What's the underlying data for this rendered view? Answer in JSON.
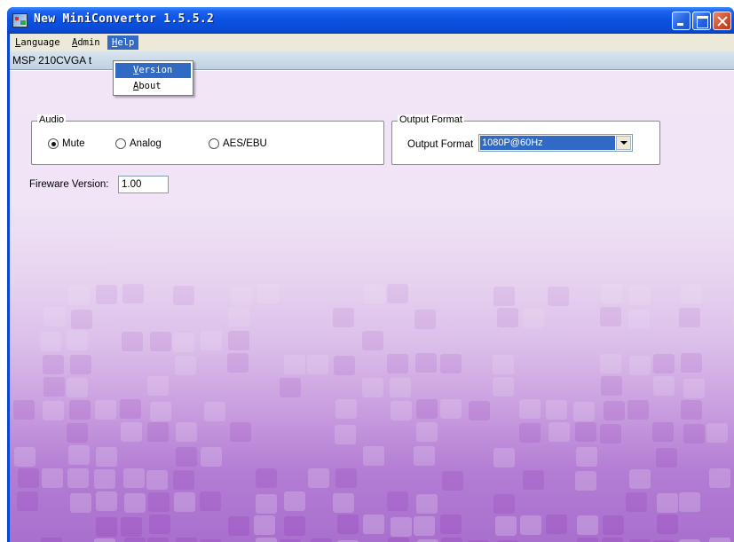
{
  "window": {
    "title": "New MiniConvertor 1.5.5.2"
  },
  "menubar": {
    "items": [
      {
        "label_underline": "L",
        "label_rest": "anguage"
      },
      {
        "label_underline": "A",
        "label_rest": "dmin"
      },
      {
        "label_underline": "H",
        "label_rest": "elp"
      }
    ]
  },
  "help_menu": {
    "items": [
      {
        "label_underline": "V",
        "label_rest": "ersion"
      },
      {
        "label_underline": "A",
        "label_rest": "bout"
      }
    ]
  },
  "device_tab": {
    "label": "MSP 210CVGA t"
  },
  "audio": {
    "legend": "Audio",
    "options": [
      "Mute",
      "Analog",
      "AES/EBU"
    ],
    "selected": "Mute"
  },
  "output_format": {
    "legend": "Output Format",
    "label": "Output Format",
    "value": "1080P@60Hz"
  },
  "firmware": {
    "label": "Fireware Version:",
    "value": "1.00"
  },
  "colors": {
    "title_bar": "#0b51e0",
    "selection": "#316ac5",
    "menu_bar": "#ece9d8"
  }
}
